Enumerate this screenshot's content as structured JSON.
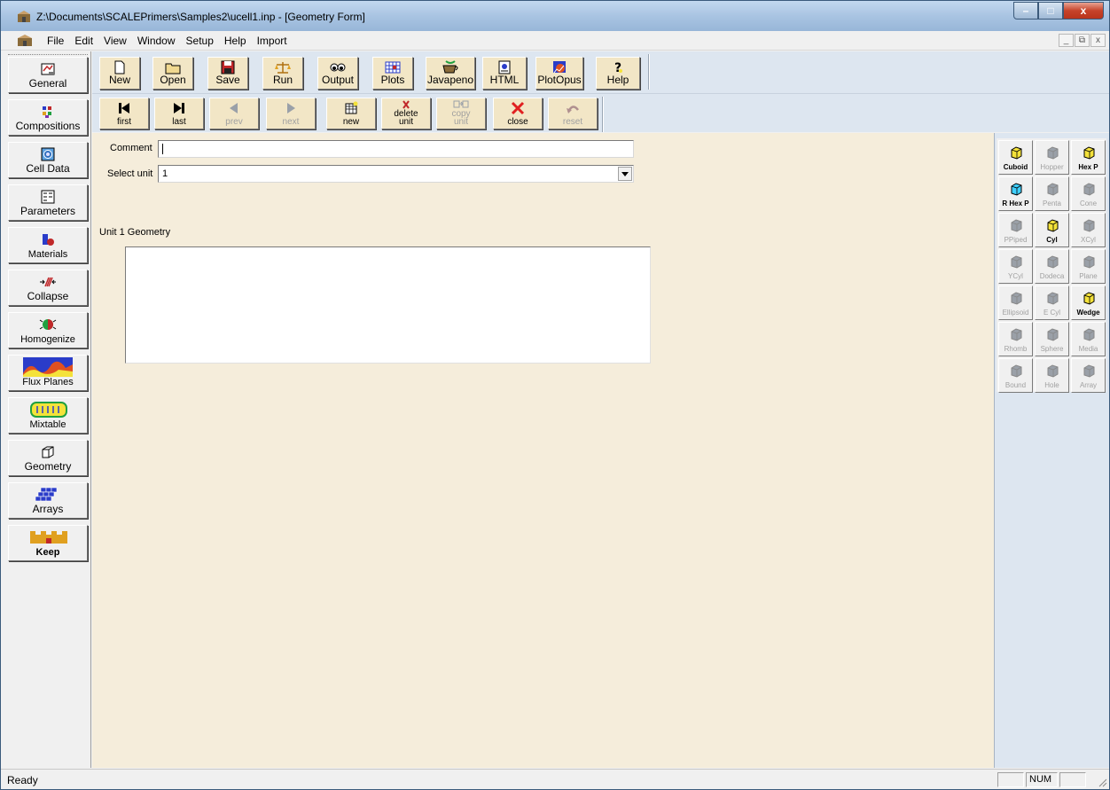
{
  "window": {
    "title": "Z:\\Documents\\SCALEPrimers\\Samples2\\ucell1.inp - [Geometry Form]",
    "minimize_glyph": "–",
    "maximize_glyph": "□",
    "close_glyph": "x"
  },
  "menu": {
    "items": [
      "File",
      "Edit",
      "View",
      "Window",
      "Setup",
      "Help",
      "Import"
    ],
    "mdi": {
      "minimize": "_",
      "restore": "⧉",
      "close": "x"
    }
  },
  "sidebar": {
    "items": [
      "General",
      "Compositions",
      "Cell Data",
      "Parameters",
      "Materials",
      "Collapse",
      "Homogenize",
      "Flux Planes",
      "Mixtable",
      "Geometry",
      "Arrays",
      "Keep"
    ]
  },
  "toolbar": {
    "buttons": [
      "New",
      "Open",
      "Save",
      "Run",
      "Output",
      "Plots",
      "Javapeno",
      "HTML",
      "PlotOpus",
      "Help"
    ]
  },
  "navbar": {
    "first": "first",
    "last": "last",
    "prev": "prev",
    "next": "next",
    "new": "new",
    "delete_l1": "delete",
    "delete_l2": "unit",
    "copy_l1": "copy",
    "copy_l2": "unit",
    "close": "close",
    "reset": "reset"
  },
  "form": {
    "comment_label": "Comment",
    "comment_value": "",
    "select_unit_label": "Select unit",
    "select_unit_value": "1",
    "geometry_heading": "Unit 1 Geometry"
  },
  "palette": {
    "shapes": [
      {
        "label": "Cuboid",
        "enabled": true
      },
      {
        "label": "Hopper",
        "enabled": false
      },
      {
        "label": "Hex P",
        "enabled": true
      },
      {
        "label": "R Hex P",
        "enabled": true
      },
      {
        "label": "Penta",
        "enabled": false
      },
      {
        "label": "Cone",
        "enabled": false
      },
      {
        "label": "PPiped",
        "enabled": false
      },
      {
        "label": "Cyl",
        "enabled": true
      },
      {
        "label": "XCyl",
        "enabled": false
      },
      {
        "label": "YCyl",
        "enabled": false
      },
      {
        "label": "Dodeca",
        "enabled": false
      },
      {
        "label": "Plane",
        "enabled": false
      },
      {
        "label": "Ellipsoid",
        "enabled": false
      },
      {
        "label": "E Cyl",
        "enabled": false
      },
      {
        "label": "Wedge",
        "enabled": true
      },
      {
        "label": "Rhomb",
        "enabled": false
      },
      {
        "label": "Sphere",
        "enabled": false
      },
      {
        "label": "Media",
        "enabled": false
      },
      {
        "label": "Bound",
        "enabled": false
      },
      {
        "label": "Hole",
        "enabled": false
      },
      {
        "label": "Array",
        "enabled": false
      }
    ]
  },
  "status": {
    "text": "Ready",
    "num": "NUM"
  },
  "colors": {
    "toolbar_button": "#f2e6c6",
    "form_background": "#f5eddb",
    "band_background": "#dde6f0",
    "accent_red": "#c0282a",
    "accent_yellow": "#f4e23a"
  }
}
